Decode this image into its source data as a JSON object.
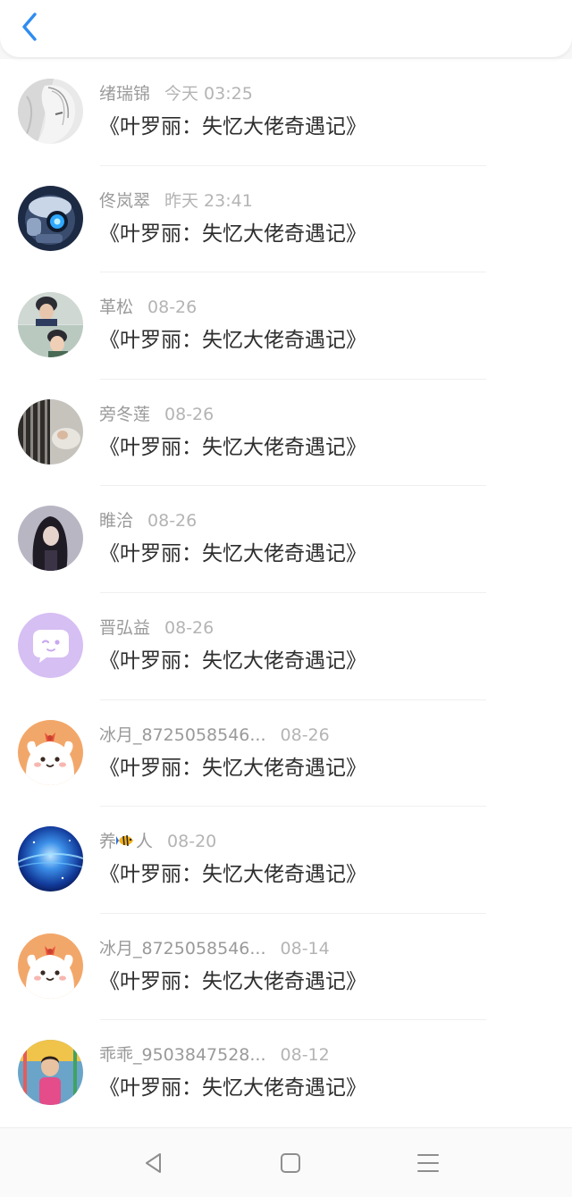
{
  "header": {
    "back_icon": "chevron-left-icon",
    "accent_color": "#2f8cf0"
  },
  "items": [
    {
      "name": "绪瑞锦",
      "time": "今天 03:25",
      "title": "《叶罗丽：失忆大佬奇遇记》",
      "avatar": "grayscale-anime-avatar"
    },
    {
      "name": "佟岚翠",
      "time": "昨天 23:41",
      "title": "《叶罗丽：失忆大佬奇遇记》",
      "avatar": "robot-avatar"
    },
    {
      "name": "革松",
      "time": "08-26",
      "title": "《叶罗丽：失忆大佬奇遇记》",
      "avatar": "photo-collage-avatar"
    },
    {
      "name": "旁冬莲",
      "time": "08-26",
      "title": "《叶罗丽：失忆大佬奇遇记》",
      "avatar": "window-bars-avatar"
    },
    {
      "name": "睢洽",
      "time": "08-26",
      "title": "《叶罗丽：失忆大佬奇遇记》",
      "avatar": "dark-hair-girl-avatar"
    },
    {
      "name": "晋弘益",
      "time": "08-26",
      "title": "《叶罗丽：失忆大佬奇遇记》",
      "avatar": "purple-chat-bubble-avatar"
    },
    {
      "name": "冰月_8725058546...",
      "time": "08-26",
      "title": "《叶罗丽：失忆大佬奇遇记》",
      "avatar": "cartoon-dog-avatar"
    },
    {
      "name_before": "养",
      "name_after": "人",
      "name_icon": "tropical-fish-emoji",
      "time": "08-20",
      "title": "《叶罗丽：失忆大佬奇遇记》",
      "avatar": "blue-galaxy-avatar"
    },
    {
      "name": "冰月_8725058546...",
      "time": "08-14",
      "title": "《叶罗丽：失忆大佬奇遇记》",
      "avatar": "cartoon-dog-avatar"
    },
    {
      "name": "乖乖_9503847528...",
      "time": "08-12",
      "title": "《叶罗丽：失忆大佬奇遇记》",
      "avatar": "child-photo-avatar"
    }
  ],
  "navbar": {
    "back_icon": "triangle-back-icon",
    "home_icon": "square-home-icon",
    "menu_icon": "hamburger-menu-icon"
  }
}
